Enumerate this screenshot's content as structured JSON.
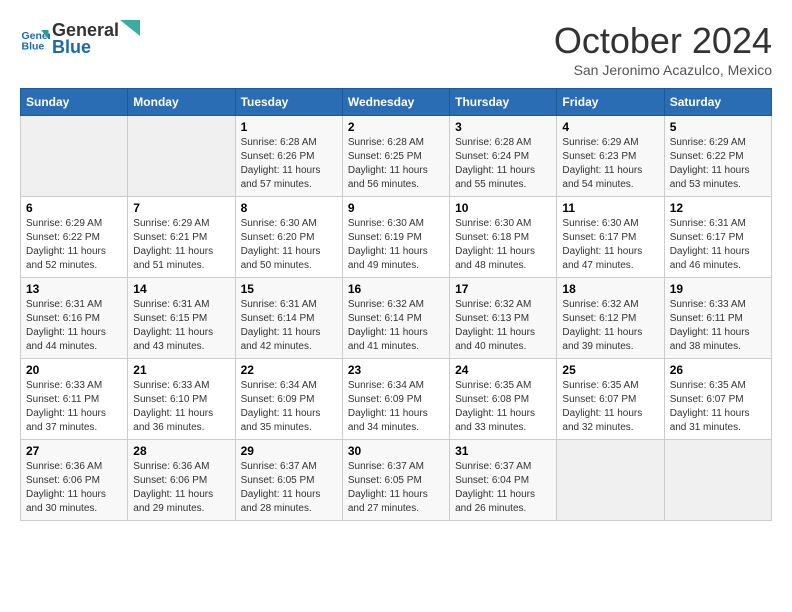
{
  "logo": {
    "line1": "General",
    "line2": "Blue"
  },
  "title": "October 2024",
  "location": "San Jeronimo Acazulco, Mexico",
  "days_of_week": [
    "Sunday",
    "Monday",
    "Tuesday",
    "Wednesday",
    "Thursday",
    "Friday",
    "Saturday"
  ],
  "weeks": [
    [
      {
        "day": "",
        "content": ""
      },
      {
        "day": "",
        "content": ""
      },
      {
        "day": "1",
        "content": "Sunrise: 6:28 AM\nSunset: 6:26 PM\nDaylight: 11 hours and 57 minutes."
      },
      {
        "day": "2",
        "content": "Sunrise: 6:28 AM\nSunset: 6:25 PM\nDaylight: 11 hours and 56 minutes."
      },
      {
        "day": "3",
        "content": "Sunrise: 6:28 AM\nSunset: 6:24 PM\nDaylight: 11 hours and 55 minutes."
      },
      {
        "day": "4",
        "content": "Sunrise: 6:29 AM\nSunset: 6:23 PM\nDaylight: 11 hours and 54 minutes."
      },
      {
        "day": "5",
        "content": "Sunrise: 6:29 AM\nSunset: 6:22 PM\nDaylight: 11 hours and 53 minutes."
      }
    ],
    [
      {
        "day": "6",
        "content": "Sunrise: 6:29 AM\nSunset: 6:22 PM\nDaylight: 11 hours and 52 minutes."
      },
      {
        "day": "7",
        "content": "Sunrise: 6:29 AM\nSunset: 6:21 PM\nDaylight: 11 hours and 51 minutes."
      },
      {
        "day": "8",
        "content": "Sunrise: 6:30 AM\nSunset: 6:20 PM\nDaylight: 11 hours and 50 minutes."
      },
      {
        "day": "9",
        "content": "Sunrise: 6:30 AM\nSunset: 6:19 PM\nDaylight: 11 hours and 49 minutes."
      },
      {
        "day": "10",
        "content": "Sunrise: 6:30 AM\nSunset: 6:18 PM\nDaylight: 11 hours and 48 minutes."
      },
      {
        "day": "11",
        "content": "Sunrise: 6:30 AM\nSunset: 6:17 PM\nDaylight: 11 hours and 47 minutes."
      },
      {
        "day": "12",
        "content": "Sunrise: 6:31 AM\nSunset: 6:17 PM\nDaylight: 11 hours and 46 minutes."
      }
    ],
    [
      {
        "day": "13",
        "content": "Sunrise: 6:31 AM\nSunset: 6:16 PM\nDaylight: 11 hours and 44 minutes."
      },
      {
        "day": "14",
        "content": "Sunrise: 6:31 AM\nSunset: 6:15 PM\nDaylight: 11 hours and 43 minutes."
      },
      {
        "day": "15",
        "content": "Sunrise: 6:31 AM\nSunset: 6:14 PM\nDaylight: 11 hours and 42 minutes."
      },
      {
        "day": "16",
        "content": "Sunrise: 6:32 AM\nSunset: 6:14 PM\nDaylight: 11 hours and 41 minutes."
      },
      {
        "day": "17",
        "content": "Sunrise: 6:32 AM\nSunset: 6:13 PM\nDaylight: 11 hours and 40 minutes."
      },
      {
        "day": "18",
        "content": "Sunrise: 6:32 AM\nSunset: 6:12 PM\nDaylight: 11 hours and 39 minutes."
      },
      {
        "day": "19",
        "content": "Sunrise: 6:33 AM\nSunset: 6:11 PM\nDaylight: 11 hours and 38 minutes."
      }
    ],
    [
      {
        "day": "20",
        "content": "Sunrise: 6:33 AM\nSunset: 6:11 PM\nDaylight: 11 hours and 37 minutes."
      },
      {
        "day": "21",
        "content": "Sunrise: 6:33 AM\nSunset: 6:10 PM\nDaylight: 11 hours and 36 minutes."
      },
      {
        "day": "22",
        "content": "Sunrise: 6:34 AM\nSunset: 6:09 PM\nDaylight: 11 hours and 35 minutes."
      },
      {
        "day": "23",
        "content": "Sunrise: 6:34 AM\nSunset: 6:09 PM\nDaylight: 11 hours and 34 minutes."
      },
      {
        "day": "24",
        "content": "Sunrise: 6:35 AM\nSunset: 6:08 PM\nDaylight: 11 hours and 33 minutes."
      },
      {
        "day": "25",
        "content": "Sunrise: 6:35 AM\nSunset: 6:07 PM\nDaylight: 11 hours and 32 minutes."
      },
      {
        "day": "26",
        "content": "Sunrise: 6:35 AM\nSunset: 6:07 PM\nDaylight: 11 hours and 31 minutes."
      }
    ],
    [
      {
        "day": "27",
        "content": "Sunrise: 6:36 AM\nSunset: 6:06 PM\nDaylight: 11 hours and 30 minutes."
      },
      {
        "day": "28",
        "content": "Sunrise: 6:36 AM\nSunset: 6:06 PM\nDaylight: 11 hours and 29 minutes."
      },
      {
        "day": "29",
        "content": "Sunrise: 6:37 AM\nSunset: 6:05 PM\nDaylight: 11 hours and 28 minutes."
      },
      {
        "day": "30",
        "content": "Sunrise: 6:37 AM\nSunset: 6:05 PM\nDaylight: 11 hours and 27 minutes."
      },
      {
        "day": "31",
        "content": "Sunrise: 6:37 AM\nSunset: 6:04 PM\nDaylight: 11 hours and 26 minutes."
      },
      {
        "day": "",
        "content": ""
      },
      {
        "day": "",
        "content": ""
      }
    ]
  ]
}
